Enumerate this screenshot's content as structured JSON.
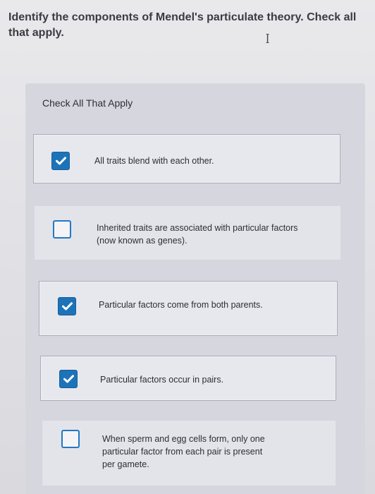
{
  "question": {
    "text": "Identify the components of Mendel's particulate theory. Check all that apply."
  },
  "panel": {
    "heading": "Check All That Apply"
  },
  "options": [
    {
      "label": "All traits blend with each other.",
      "checked": true
    },
    {
      "label": "Inherited traits are associated with particular factors (now known as genes).",
      "checked": false
    },
    {
      "label": "Particular factors come from both parents.",
      "checked": true
    },
    {
      "label": "Particular factors occur in pairs.",
      "checked": true
    },
    {
      "label": "When sperm and egg cells form, only one particular factor from each pair is present per gamete.",
      "checked": false
    }
  ],
  "colors": {
    "checkbox_accent": "#1d73b8"
  },
  "icons": {
    "text_cursor": "I-beam-cursor-icon",
    "check": "checkmark-icon"
  }
}
